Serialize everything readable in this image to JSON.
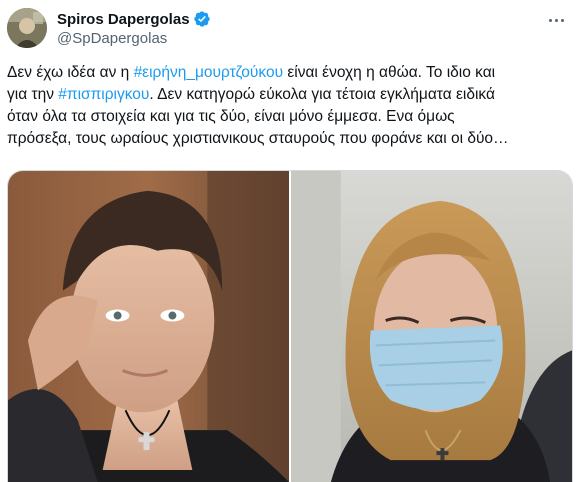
{
  "tweet": {
    "author": {
      "display_name": "Spiros Dapergolas",
      "handle": "@SpDapergolas",
      "verified": true,
      "verified_color": "#1d9bf0"
    },
    "text_lines": [
      {
        "before": "Δεν έχω ιδέα αν η ",
        "hashtag": "#ειρήνη_μουρτζούκου",
        "after": " είναι ένοχη η αθώα. Το ιδιο και"
      },
      {
        "before": "για την ",
        "hashtag": "#πισπιριγκου",
        "after": ". Δεν κατηγορώ εύκολα για τέτοια εγκλήματα ειδικά"
      },
      {
        "before": "όταν όλα τα στοιχεία και για τις δύο, είναι μόνο έμμεσα. Ενα όμως",
        "hashtag": "",
        "after": ""
      },
      {
        "before": "πρόσεξα, τους ωραίους χριστιανικους σταυρούς που φοράνε και οι δύο…",
        "hashtag": "",
        "after": ""
      }
    ],
    "hashtag_color": "#1d9bf0",
    "media": [
      {
        "icon": "photo-young-person-with-cross-necklace"
      },
      {
        "icon": "photo-woman-with-face-mask"
      }
    ]
  }
}
